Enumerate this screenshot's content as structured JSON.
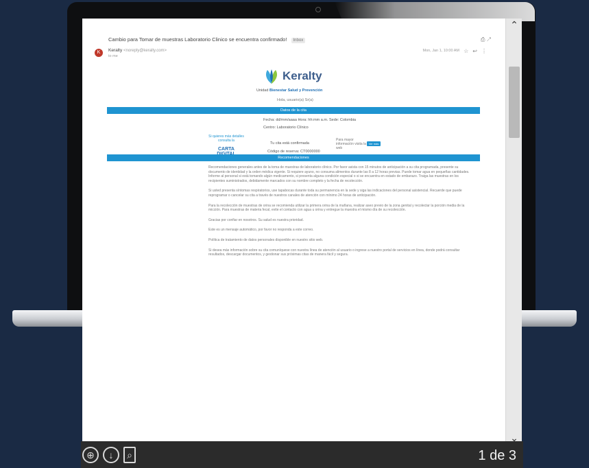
{
  "viewer": {
    "mail": {
      "subject": "Cambio para Tomar de muestras Laboratorio Clinico se encuentra confirmado!",
      "badge": "Inbox",
      "sender_name": "Keralty",
      "sender_email": "<noreply@keralty.com>",
      "to": "to me",
      "date": "Mon, Jan 1, 10:00 AM"
    },
    "brand": {
      "name": "Keralty",
      "tagline_prefix": "Unidad",
      "tagline_bold": "Bienestar Salud y Prevención"
    },
    "header_line": "Hola, usuario(a) Sr(a)",
    "band1": "Datos de la cita",
    "info1": "Fecha: dd/mm/aaaa Hora: hh:mm a.m. Sede: Colombia",
    "info2": "Centro: Laboratorio Clínico",
    "cta_left_small": "Si quieres más detalles consulta la",
    "cta_left_big": "CARTA DIGITAL",
    "cta_mid": "Tu cita está confirmada",
    "cta_right": "Para mayor información visita la web",
    "cta_button": "Ver más",
    "code_line": "Código de reserva: CT0000000",
    "band2": "Recomendaciones",
    "paragraphs": [
      "Recomendaciones generales antes de la toma de muestras de laboratorio clínico. Por favor asista con 15 minutos de anticipación a su cita programada, presente su documento de identidad y la orden médica vigente. Si requiere ayuno, no consuma alimentos durante las 8 a 12 horas previas. Puede tomar agua en pequeñas cantidades. Informe al personal si está tomando algún medicamento, si presenta alguna condición especial o si se encuentra en estado de embarazo. Traiga las muestras en los recipientes suministrados, debidamente marcados con su nombre completo y la fecha de recolección.",
      "Si usted presenta síntomas respiratorios, use tapabocas durante toda su permanencia en la sede y siga las indicaciones del personal asistencial. Recuerde que puede reprogramar o cancelar su cita a través de nuestros canales de atención con mínimo 24 horas de anticipación.",
      "Para la recolección de muestras de orina se recomienda utilizar la primera orina de la mañana, realizar aseo previo de la zona genital y recolectar la porción media de la micción. Para muestras de materia fecal, evite el contacto con agua u orina y entregue la muestra el mismo día de su recolección.",
      "Gracias por confiar en nosotros. Su salud es nuestra prioridad.",
      "Este es un mensaje automático, por favor no responda a este correo.",
      "Política de tratamiento de datos personales disponible en nuestro sitio web.",
      "Si desea más información sobre su cita comuníquese con nuestra línea de atención al usuario o ingrese a nuestro portal de servicios en línea, donde podrá consultar resultados, descargar documentos, y gestionar sus próximas citas de manera fácil y segura."
    ]
  },
  "toolbar": {
    "page_counter": "1 de 3"
  }
}
